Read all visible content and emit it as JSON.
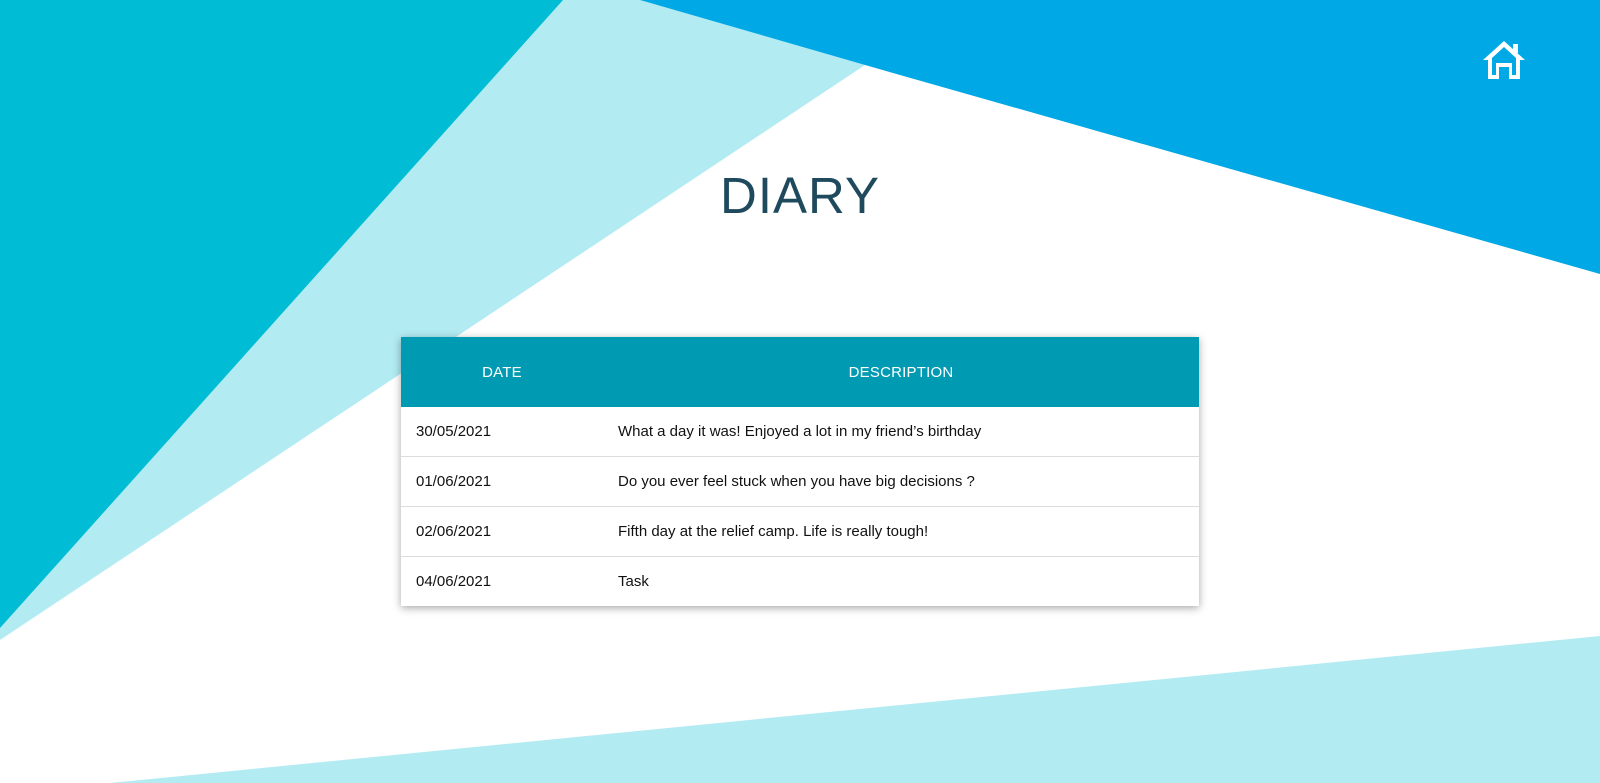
{
  "header": {
    "title": "DIARY",
    "home_icon": "home-icon"
  },
  "colors": {
    "accent_dark": "#00BCD4",
    "accent_blue": "#00A8E6",
    "accent_light": "#B2EBF2",
    "table_header": "#009BB3",
    "title_text": "#1F4A5E"
  },
  "table": {
    "columns": [
      "DATE",
      "DESCRIPTION"
    ],
    "rows": [
      {
        "date": "30/05/2021",
        "description": "What a day it was! Enjoyed a lot in my friend’s birthday"
      },
      {
        "date": "01/06/2021",
        "description": "Do you ever feel stuck when you have big decisions ?"
      },
      {
        "date": "02/06/2021",
        "description": "Fifth day at the relief camp. Life is really tough!"
      },
      {
        "date": "04/06/2021",
        "description": "Task"
      }
    ]
  }
}
